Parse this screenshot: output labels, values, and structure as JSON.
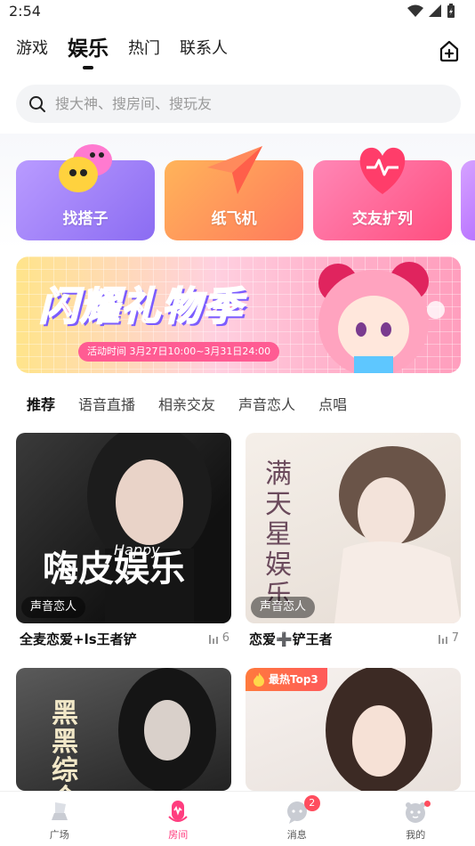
{
  "status_bar": {
    "time": "2:54"
  },
  "top_tabs": [
    {
      "label": "游戏",
      "active": false
    },
    {
      "label": "娱乐",
      "active": true
    },
    {
      "label": "热门",
      "active": false
    },
    {
      "label": "联系人",
      "active": false
    }
  ],
  "search": {
    "placeholder": "搜大神、搜房间、搜玩友"
  },
  "feature_cards": [
    {
      "label": "找搭子"
    },
    {
      "label": "纸飞机"
    },
    {
      "label": "交友扩列"
    }
  ],
  "banner": {
    "title": "闪耀礼物季",
    "date_text": "活动时间 3月27日10:00~3月31日24:00"
  },
  "sub_tabs": [
    {
      "label": "推荐",
      "active": true
    },
    {
      "label": "语音直播",
      "active": false
    },
    {
      "label": "相亲交友",
      "active": false
    },
    {
      "label": "声音恋人",
      "active": false
    },
    {
      "label": "点唱",
      "active": false
    }
  ],
  "rooms": [
    {
      "title": "全麦恋爱+ls王者铲",
      "tag": "声音恋人",
      "count": "6",
      "cover_text": "嗨皮娱乐",
      "cover_sub": "Happy"
    },
    {
      "title": "恋爱➕铲王者",
      "tag": "声音恋人",
      "count": "7",
      "cover_text": "满天星娱乐"
    },
    {
      "title": "",
      "cover_text": "黑黑综合"
    },
    {
      "title": "",
      "hot_badge": "最热Top3"
    }
  ],
  "bottom_nav": [
    {
      "label": "广场",
      "active": false
    },
    {
      "label": "房间",
      "active": true
    },
    {
      "label": "消息",
      "active": false,
      "badge": "2"
    },
    {
      "label": "我的",
      "active": false,
      "dot": true
    }
  ],
  "colors": {
    "accent": "#ff3d7f",
    "badge": "#ff4d5e"
  }
}
